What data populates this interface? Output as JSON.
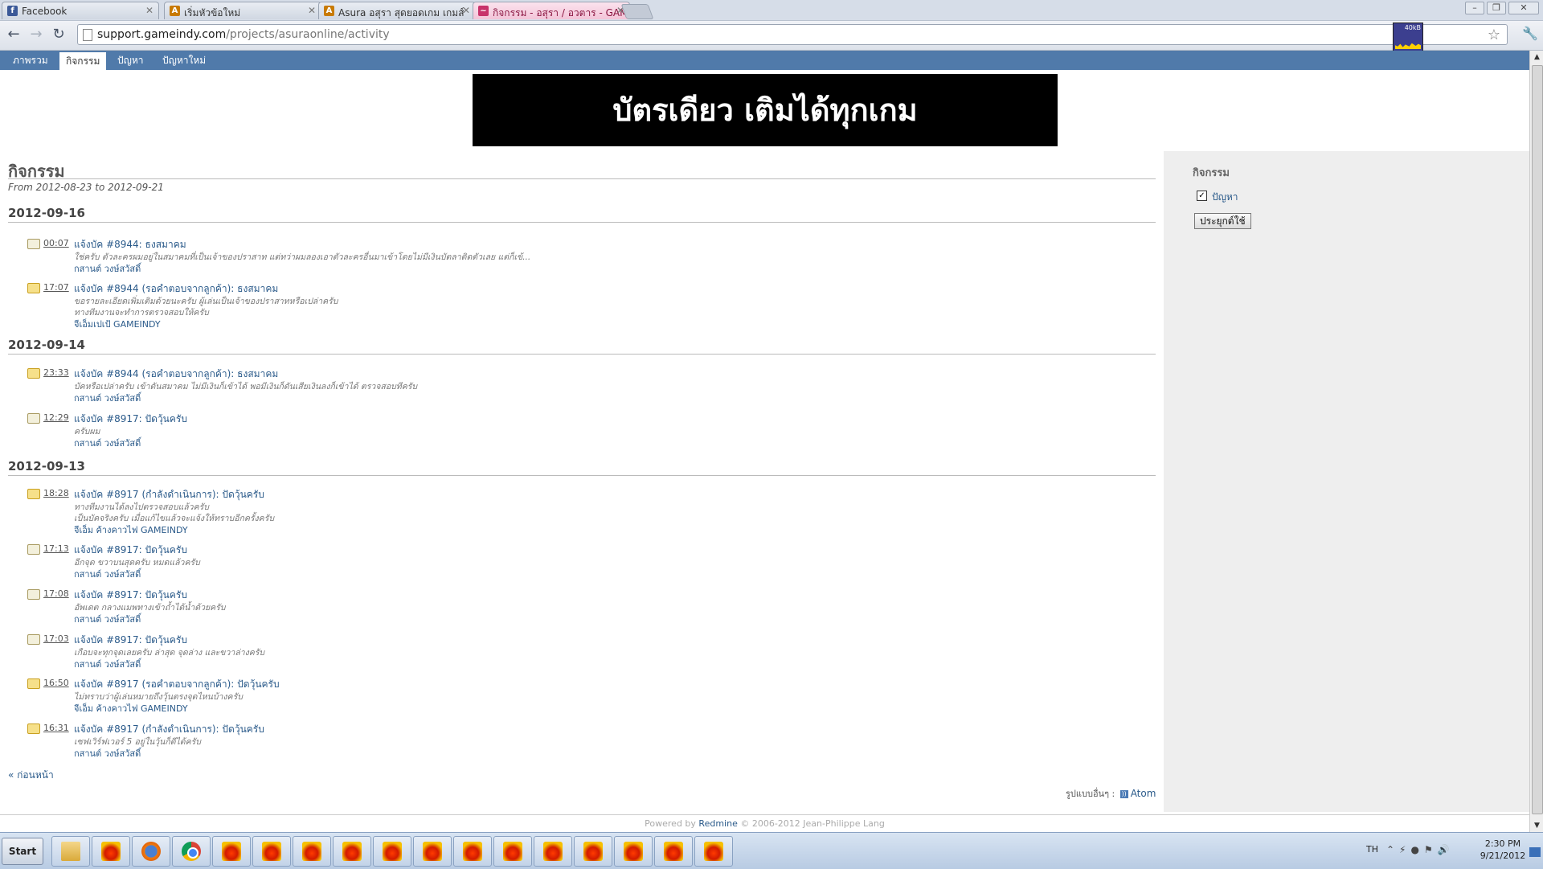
{
  "browser": {
    "tabs": [
      {
        "title": "Facebook",
        "icon": "facebook-icon",
        "color": "#3b5998",
        "glyph": "f"
      },
      {
        "title": "เริ่มหัวข้อใหม่",
        "icon": "asura-icon",
        "color": "#c87a00",
        "glyph": "A"
      },
      {
        "title": "Asura อสุรา สุดยอดเกม เกมส์",
        "icon": "asura-icon",
        "color": "#c87a00",
        "glyph": "A"
      },
      {
        "title": "กิจกรรม - อสุรา / อวตาร - GAM",
        "icon": "loading-icon",
        "color": "#c8326a",
        "glyph": "~"
      }
    ],
    "url_host": "support.gameindy.com",
    "url_path": "/projects/asuraonline/activity",
    "net_meter": "40kB"
  },
  "top_menu": [
    "ภาพรวม",
    "กิจกรรม",
    "ปัญหา",
    "ปัญหาใหม่"
  ],
  "banner_text": "บัตรเดียว เติมได้ทุกเกม",
  "page": {
    "title": "กิจกรรม",
    "subtitle": "From 2012-08-23 to 2012-09-21"
  },
  "days": [
    {
      "date": "2012-09-16",
      "events": [
        {
          "time": "00:07",
          "title": "แจ้งบัค #8944: ธงสมาคม",
          "desc": [
            "ใช่ครับ ตัวละครผมอยู่ในสมาคมที่เป็นเจ้าของปราสาท แต่ทว่าผมลองเอาตัวละครอื่นมาเข้าโดยไม่มีเงินบัตลาติดตัวเลย แต่ก็เข้..."
          ],
          "author": "กสานต์ วงษ์สวัสดิ์",
          "icon": "note-icon"
        },
        {
          "time": "17:07",
          "title": "แจ้งบัค #8944 (รอคำตอบจากลูกค้า): ธงสมาคม",
          "desc": [
            "ขอรายละเอียดเพิ่มเติมด้วยนะครับ ผู้เล่นเป็นเจ้าของปราสาทหรือเปล่าครับ",
            "ทางทีมงานจะทำการตรวจสอบให้ครับ"
          ],
          "author": "จีเอ็มเปเป้ GAMEINDY",
          "icon": "edit-icon"
        }
      ]
    },
    {
      "date": "2012-09-14",
      "events": [
        {
          "time": "23:33",
          "title": "แจ้งบัค #8944 (รอคำตอบจากลูกค้า): ธงสมาคม",
          "desc": [
            "บัคหรือเปล่าครับ เข้าดันสมาคม ไม่มีเงินก็เข้าได้ พอมีเงินก็ดันเสียเงินลงก็เข้าได้ ตรวจสอบทีครับ"
          ],
          "author": "กสานต์ วงษ์สวัสดิ์",
          "icon": "ticket-icon"
        },
        {
          "time": "12:29",
          "title": "แจ้งบัค #8917: ปัดวุ้นครับ",
          "desc": [
            "ครับผม"
          ],
          "author": "กสานต์ วงษ์สวัสดิ์",
          "icon": "note-icon"
        }
      ]
    },
    {
      "date": "2012-09-13",
      "events": [
        {
          "time": "18:28",
          "title": "แจ้งบัค #8917 (กำลังดำเนินการ): ปัดวุ้นครับ",
          "desc": [
            "ทางทีมงานได้ลงไปตรวจสอบแล้วครับ",
            "เป็นบัคจริงครับ เมื่อแก้ไขแล้วจะแจ้งให้ทราบอีกครั้งครับ"
          ],
          "author": "จีเอ็ม ค้างคาวไฟ GAMEINDY",
          "icon": "edit-icon"
        },
        {
          "time": "17:13",
          "title": "แจ้งบัค #8917: ปัดวุ้นครับ",
          "desc": [
            "อีกจุด ขวาบนสุดครับ หมดแล้วครับ"
          ],
          "author": "กสานต์ วงษ์สวัสดิ์",
          "icon": "note-icon"
        },
        {
          "time": "17:08",
          "title": "แจ้งบัค #8917: ปัดวุ้นครับ",
          "desc": [
            "อัพเดต กลางแมพทางเข้าถ้ำได้น้ำด้วยครับ"
          ],
          "author": "กสานต์ วงษ์สวัสดิ์",
          "icon": "note-icon"
        },
        {
          "time": "17:03",
          "title": "แจ้งบัค #8917: ปัดวุ้นครับ",
          "desc": [
            "เกือบจะทุกจุดเลยครับ ล่าสุด จุดล่าง และขวาล่างครับ"
          ],
          "author": "กสานต์ วงษ์สวัสดิ์",
          "icon": "note-icon"
        },
        {
          "time": "16:50",
          "title": "แจ้งบัค #8917 (รอคำตอบจากลูกค้า): ปัดวุ้นครับ",
          "desc": [
            "ไม่ทราบว่าผู้เล่นหมายถึงวุ้นตรงจุดไหนบ้างครับ"
          ],
          "author": "จีเอ็ม ค้างคาวไฟ GAMEINDY",
          "icon": "edit-icon"
        },
        {
          "time": "16:31",
          "title": "แจ้งบัค #8917 (กำลังดำเนินการ): ปัดวุ้นครับ",
          "desc": [
            "เซฟเวิร์ฟเวอร์ 5 อยู่ในวุ้นก็ดีได้ครับ"
          ],
          "author": "กสานต์ วงษ์สวัสดิ์",
          "icon": "ticket-icon"
        }
      ]
    }
  ],
  "prev_link": "« ก่อนหน้า",
  "formats_label": "รูปแบบอื่นๆ :",
  "atom_label": "Atom",
  "footer": {
    "prefix": "Powered by",
    "link": "Redmine",
    "suffix": "© 2006-2012 Jean-Philippe Lang"
  },
  "sidebar": {
    "title": "กิจกรรม",
    "filter_label": "ปัญหา",
    "filter_checked": true,
    "apply_label": "ประยุกต์ใช้"
  },
  "taskbar": {
    "start_label": "Start",
    "lang": "TH",
    "time": "2:30 PM",
    "date": "9/21/2012"
  },
  "colors": {
    "menu_bg": "#507aaa",
    "link": "#2a5a8a"
  }
}
